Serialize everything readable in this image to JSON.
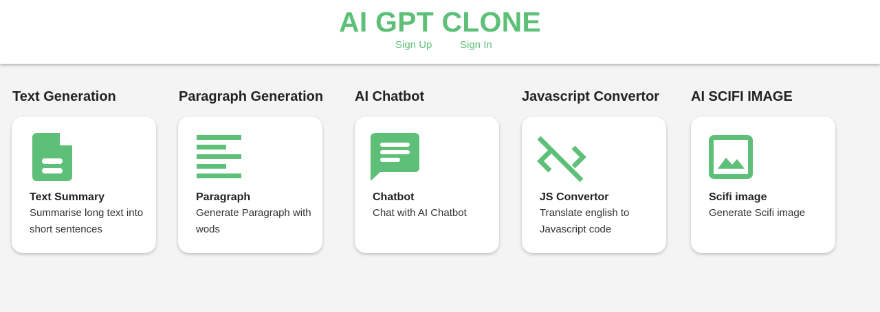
{
  "header": {
    "title": "AI GPT CLONE",
    "nav": [
      {
        "label": "Sign Up"
      },
      {
        "label": "Sign In"
      }
    ]
  },
  "sections": [
    {
      "heading": "Text Generation",
      "card": {
        "title": "Text Summary",
        "description": "Summarise long text into short sentences",
        "icon": "document-icon"
      }
    },
    {
      "heading": "Paragraph Generation",
      "card": {
        "title": "Paragraph",
        "description": "Generate Paragraph with wods",
        "icon": "align-left-icon"
      }
    },
    {
      "heading": "AI Chatbot",
      "card": {
        "title": "Chatbot",
        "description": "Chat with AI Chatbot",
        "icon": "chat-icon"
      }
    },
    {
      "heading": "Javascript Convertor",
      "card": {
        "title": "JS Convertor",
        "description": "Translate english to Javascript code",
        "icon": "code-off-icon"
      }
    },
    {
      "heading": "AI SCIFI IMAGE",
      "card": {
        "title": "Scifi image",
        "description": "Generate Scifi image",
        "icon": "image-icon"
      }
    }
  ],
  "colors": {
    "accent": "#5ec078",
    "background": "#f4f4f4",
    "card": "#ffffff",
    "text": "#222222"
  }
}
